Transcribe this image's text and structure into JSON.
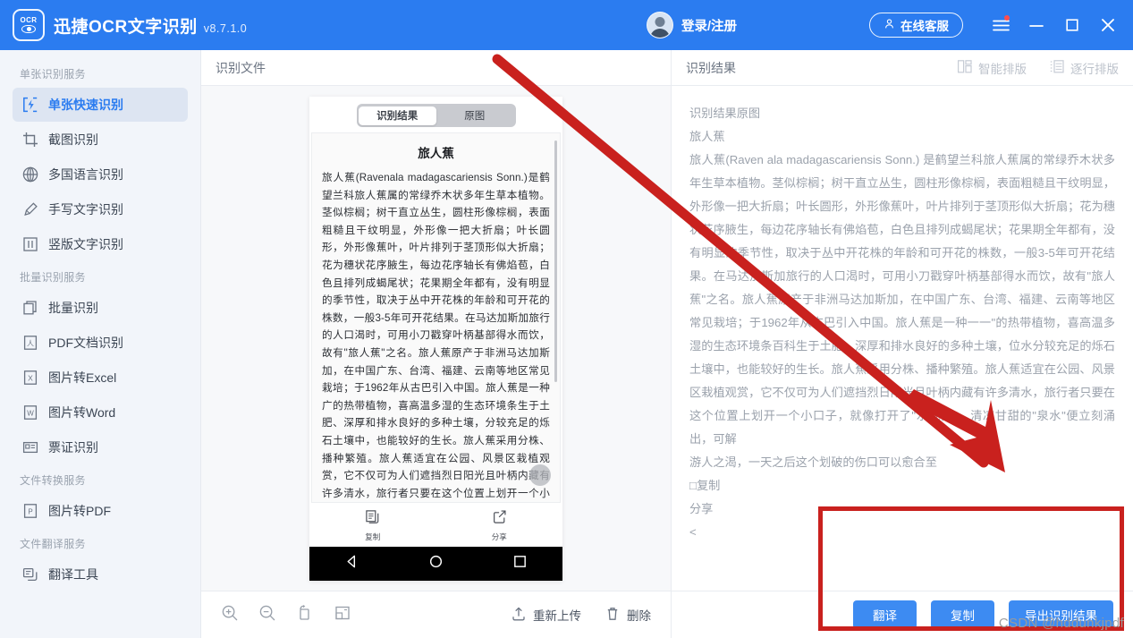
{
  "titlebar": {
    "logo_text": "OCR",
    "app_name": "迅捷OCR文字识别",
    "version": "v8.7.1.0",
    "account_label": "登录/注册",
    "support_label": "在线客服",
    "brand_color": "#2b7cf0"
  },
  "sidebar": {
    "groups": [
      {
        "title": "单张识别服务",
        "items": [
          {
            "label": "单张快速识别",
            "icon": "flash-bracket-icon",
            "active": true
          },
          {
            "label": "截图识别",
            "icon": "crop-icon",
            "active": false
          },
          {
            "label": "多国语言识别",
            "icon": "globe-icon",
            "active": false
          },
          {
            "label": "手写文字识别",
            "icon": "pen-icon",
            "active": false
          },
          {
            "label": "竖版文字识别",
            "icon": "vertical-text-icon",
            "active": false
          }
        ]
      },
      {
        "title": "批量识别服务",
        "items": [
          {
            "label": "批量识别",
            "icon": "layers-icon",
            "active": false
          },
          {
            "label": "PDF文档识别",
            "icon": "pdf-file-icon",
            "active": false
          },
          {
            "label": "图片转Excel",
            "icon": "excel-file-icon",
            "active": false
          },
          {
            "label": "图片转Word",
            "icon": "word-file-icon",
            "active": false
          },
          {
            "label": "票证识别",
            "icon": "id-card-icon",
            "active": false
          }
        ]
      },
      {
        "title": "文件转换服务",
        "items": [
          {
            "label": "图片转PDF",
            "icon": "pdf-convert-icon",
            "active": false
          }
        ]
      },
      {
        "title": "文件翻译服务",
        "items": [
          {
            "label": "翻译工具",
            "icon": "translate-icon",
            "active": false
          }
        ]
      }
    ]
  },
  "center": {
    "header": "识别文件",
    "preview": {
      "tabs": [
        {
          "label": "识别结果",
          "active": true
        },
        {
          "label": "原图",
          "active": false
        }
      ],
      "doc_title": "旅人蕉",
      "doc_body": "旅人蕉(Ravenala madagascariensis Sonn.)是鹤望兰科旅人蕉属的常绿乔木状多年生草本植物。茎似棕榈；树干直立丛生，圆柱形像棕榈，表面粗糙且干纹明显，外形像一把大折扇；叶长圆形，外形像蕉叶，叶片排列于茎顶形似大折扇；花为穗状花序腋生，每边花序轴长有佛焰苞，白色且排列成蝎尾状；花果期全年都有，没有明显的季节性，取决于丛中开花株的年龄和可开花的株数，一般3-5年可开花结果。在马达加斯加旅行的人口渴时，可用小刀戳穿叶柄基部得水而饮，故有\"旅人蕉\"之名。旅人蕉原产于非洲马达加斯加，在中国广东、台湾、福建、云南等地区常见栽培；于1962年从古巴引入中国。旅人蕉是一种广的热带植物，喜高温多湿的生态环境条生于土肥、深厚和排水良好的多种土壤，分较充足的烁石土壤中，也能较好的生长。旅人蕉采用分株、播种繁殖。旅人蕉适宜在公园、风景区栽植观赏，它不仅可为人们遮挡烈日阳光且叶柄内藏有许多清水，旅行者只要在这个位置上划开一个小口子，就像打开了\"水龙头\"，清凉甘甜的\"泉水\"便立刻涌出，可解游人之渴，一天之后这个划破的伤口可以愈合",
      "badge": "百科",
      "actions": [
        {
          "label": "复制",
          "icon": "copy-icon"
        },
        {
          "label": "分享",
          "icon": "share-icon"
        }
      ]
    },
    "toolbar": {
      "zoom_in": "zoom-in-icon",
      "zoom_out": "zoom-out-icon",
      "rotate": "rotate-icon",
      "fit": "fit-screen-icon",
      "reupload": "重新上传",
      "delete": "删除"
    }
  },
  "right": {
    "header": "识别结果",
    "layout_options": [
      {
        "label": "智能排版",
        "icon": "smart-layout-icon"
      },
      {
        "label": "逐行排版",
        "icon": "line-layout-icon"
      }
    ],
    "result_lines": [
      "识别结果原图",
      "旅人蕉",
      "旅人蕉(Raven ala madagascariensis Sonn.) 是鹤望兰科旅人蕉属的常绿乔木状多年生草本植物。茎似棕榈；树干直立丛生，圆柱形像棕榈，表面粗糙且干纹明显，外形像一把大折扇；叶长圆形，外形像蕉叶，叶片排列于茎顶形似大折扇；花为穗状花序腋生，每边花序轴长有佛焰苞，白色且排列成蝎尾状；花果期全年都有，没有明显的季节性，取决于丛中开花株的年龄和可开花的株数，一般3-5年可开花结果。在马达加斯加旅行的人口渴时，可用小刀戳穿叶柄基部得水而饮，故有\"旅人蕉\"之名。旅人蕉原产于非洲马达加斯加，在中国广东、台湾、福建、云南等地区常见栽培；于1962年从古巴引入中国。旅人蕉是一种一一\"的热带植物，喜高温多湿的生态环境条百科生于土肥、深厚和排水良好的多种土壤，位水分较充足的烁石土壤中，也能较好的生长。旅人蕉采用分株、播种繁殖。旅人蕉适宜在公园、风景区栽植观赏，它不仅可为人们遮挡烈日阳光且叶柄内藏有许多清水，旅行者只要在这个位置上划开一个小口子，就像打开了\"水龙头\"，清凉甘甜的\"泉水\"便立刻涌出，可解",
      "游人之渴，一天之后这个划破的伤口可以愈合至",
      "□复制",
      "分享",
      "<"
    ],
    "buttons": [
      {
        "label": "翻译"
      },
      {
        "label": "复制"
      },
      {
        "label": "导出识别结果"
      }
    ],
    "button_color": "#3d8bf2"
  },
  "annotations": {
    "arrow_color": "#c9211e",
    "rect_color": "#c9211e",
    "watermark": "CSDN @hddunkjpdf"
  }
}
